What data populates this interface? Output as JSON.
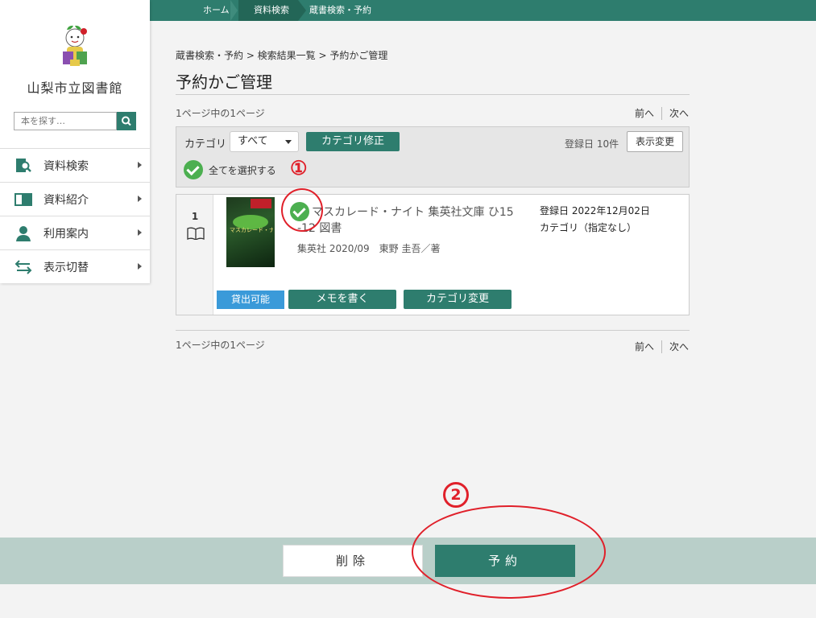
{
  "topnav": {
    "items": [
      "ホーム",
      "資料検索",
      "蔵書検索・予約"
    ]
  },
  "sidebar": {
    "library_name": "山梨市立図書館",
    "search_placeholder": "本を探す…",
    "items": [
      {
        "label": "資料検索",
        "icon": "search-book-icon"
      },
      {
        "label": "資料紹介",
        "icon": "open-book-icon"
      },
      {
        "label": "利用案内",
        "icon": "person-icon"
      },
      {
        "label": "表示切替",
        "icon": "swap-arrows-icon"
      }
    ]
  },
  "breadcrumb": "蔵書検索・予約 > 検索結果一覧 > 予約かご管理",
  "page_title": "予約かご管理",
  "pager": {
    "info": "1ページ中の1ページ",
    "prev": "前へ",
    "next": "次へ"
  },
  "panel": {
    "category_label": "カテゴリ",
    "category_value": "すべて",
    "category_fix_button": "カテゴリ修正",
    "sort_info": "登録日 10件",
    "display_change_button": "表示変更",
    "select_all_label": "全てを選択する"
  },
  "item": {
    "number": "1",
    "cover_text": "マスカレード・ナイト",
    "title_line1": "マスカレード・ナイト 集英社文庫 ひ15",
    "title_line2": "-12 図書",
    "publisher": "集英社 2020/09　東野 圭吾／著",
    "registered": "登録日 2022年12月02日",
    "category": "カテゴリ（指定なし）",
    "status_badge": "貸出可能",
    "memo_button": "メモを書く",
    "category_change_button": "カテゴリ変更"
  },
  "footer": {
    "delete_button": "削除",
    "reserve_button": "予約"
  },
  "annotations": {
    "marker1": "①",
    "marker2": "②"
  },
  "colors": {
    "brand": "#2e7d6e",
    "check": "#4caf50",
    "annotation": "#e0202a",
    "badge": "#3a9ad9"
  }
}
